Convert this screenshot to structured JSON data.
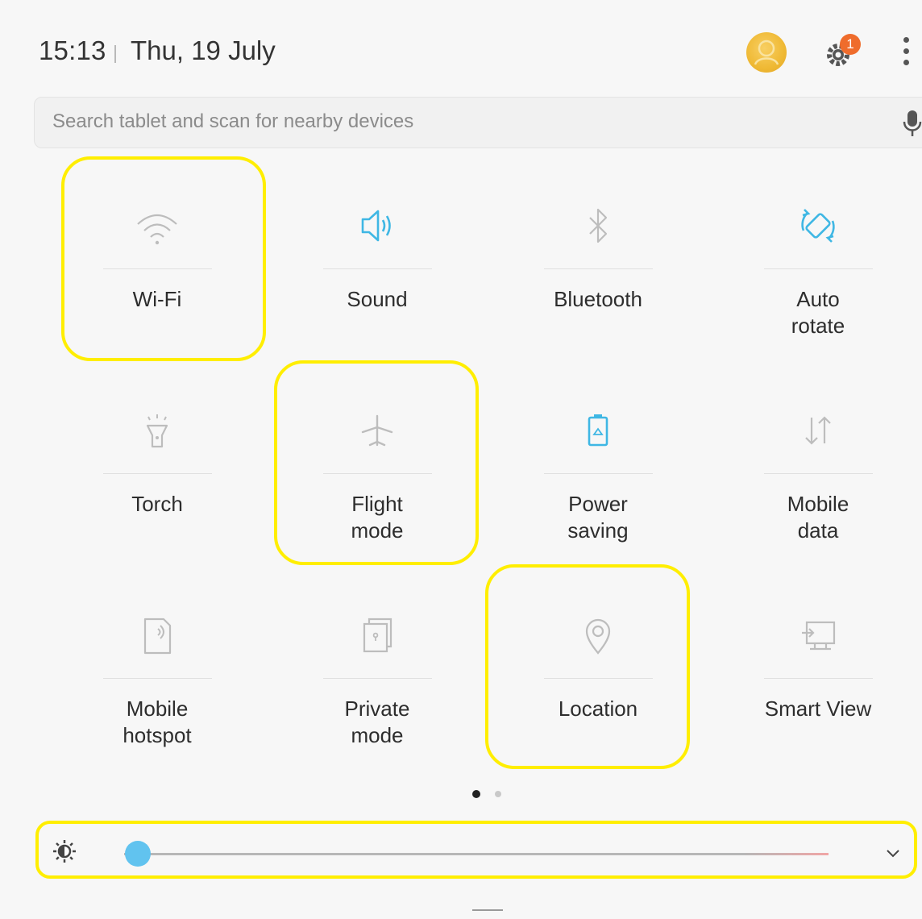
{
  "header": {
    "time": "15:13",
    "date": "Thu, 19 July",
    "settings_badge": "1"
  },
  "search": {
    "placeholder": "Search tablet and scan for nearby devices"
  },
  "tiles": [
    {
      "label": "Wi-Fi",
      "icon": "wifi-icon",
      "state": "off"
    },
    {
      "label": "Sound",
      "icon": "sound-icon",
      "state": "on"
    },
    {
      "label": "Bluetooth",
      "icon": "bluetooth-icon",
      "state": "off"
    },
    {
      "label": "Auto\nrotate",
      "icon": "auto-rotate-icon",
      "state": "on"
    },
    {
      "label": "Torch",
      "icon": "torch-icon",
      "state": "off"
    },
    {
      "label": "Flight\nmode",
      "icon": "airplane-icon",
      "state": "off"
    },
    {
      "label": "Power\nsaving",
      "icon": "battery-saver-icon",
      "state": "on"
    },
    {
      "label": "Mobile\ndata",
      "icon": "mobile-data-icon",
      "state": "off"
    },
    {
      "label": "Mobile\nhotspot",
      "icon": "hotspot-icon",
      "state": "off"
    },
    {
      "label": "Private\nmode",
      "icon": "private-mode-icon",
      "state": "off"
    },
    {
      "label": "Location",
      "icon": "location-icon",
      "state": "off"
    },
    {
      "label": "Smart View",
      "icon": "smart-view-icon",
      "state": "off"
    }
  ],
  "pager": {
    "pages": 2,
    "current": 1
  },
  "brightness": {
    "level": 0.02
  },
  "colors": {
    "accent": "#3fb7e4",
    "inactive_icon": "#b5b5b5",
    "highlight": "#ffee00",
    "badge": "#ef6c2c",
    "slider_thumb": "#61c3ef"
  }
}
